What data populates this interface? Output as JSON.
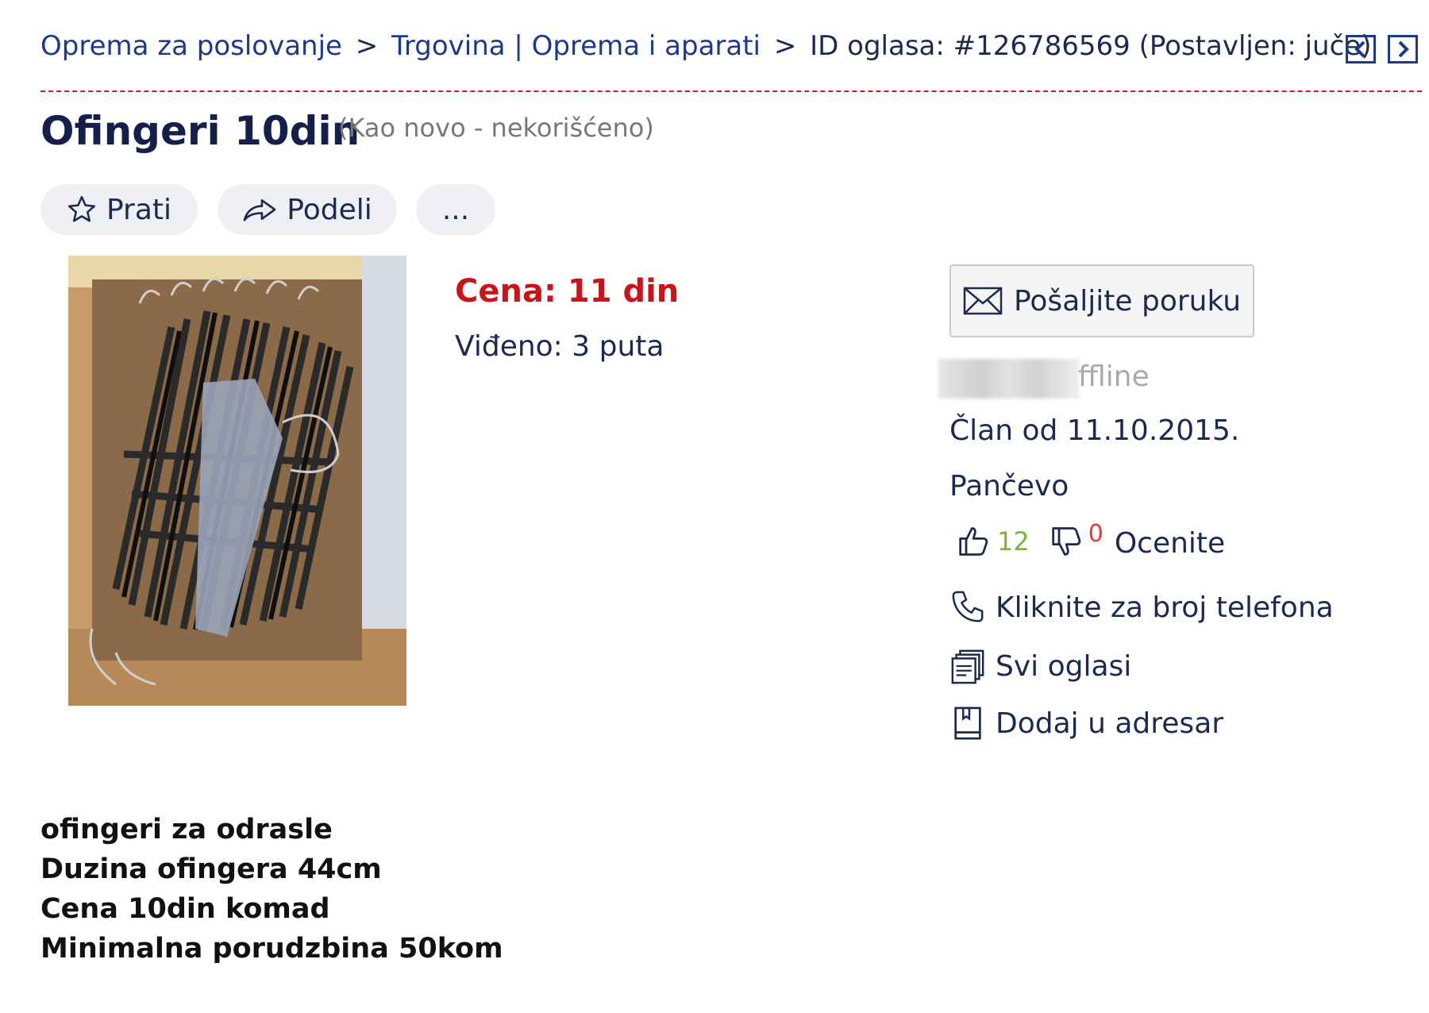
{
  "breadcrumb": {
    "items": [
      "Oprema za poslovanje",
      "Trgovina | Oprema i aparati"
    ],
    "separator": ">",
    "ad_id": "ID oglasa: #126786569 (Postavljen: juče)"
  },
  "nav": {
    "prev_icon": "chevron-left-icon",
    "next_icon": "chevron-right-icon"
  },
  "listing": {
    "title": "Ofingeri 10din",
    "condition": "(Kao novo - nekorišćeno)",
    "price": "Cena: 11 din",
    "views": "Viđeno: 3 puta"
  },
  "actions": {
    "follow_label": "Prati",
    "share_label": "Podeli",
    "more_label": "..."
  },
  "seller": {
    "send_message_label": "Pošaljite poruku",
    "status_partial": "ffline",
    "member_since": "Član od 11.10.2015.",
    "location": "Pančevo",
    "likes": "12",
    "dislikes": "0",
    "rate_label": "Ocenite",
    "phone_label": "Kliknite za broj telefona",
    "all_ads_label": "Svi oglasi",
    "address_book_label": "Dodaj u adresar"
  },
  "description": [
    "ofingeri za odrasle",
    "Duzina ofingera 44cm",
    "Cena 10din komad",
    "Minimalna porudzbina 50kom"
  ],
  "colors": {
    "accent_red": "#c8151b",
    "link_blue": "#1d3a8a",
    "like_green": "#7cb342",
    "dislike_red": "#e53935"
  }
}
